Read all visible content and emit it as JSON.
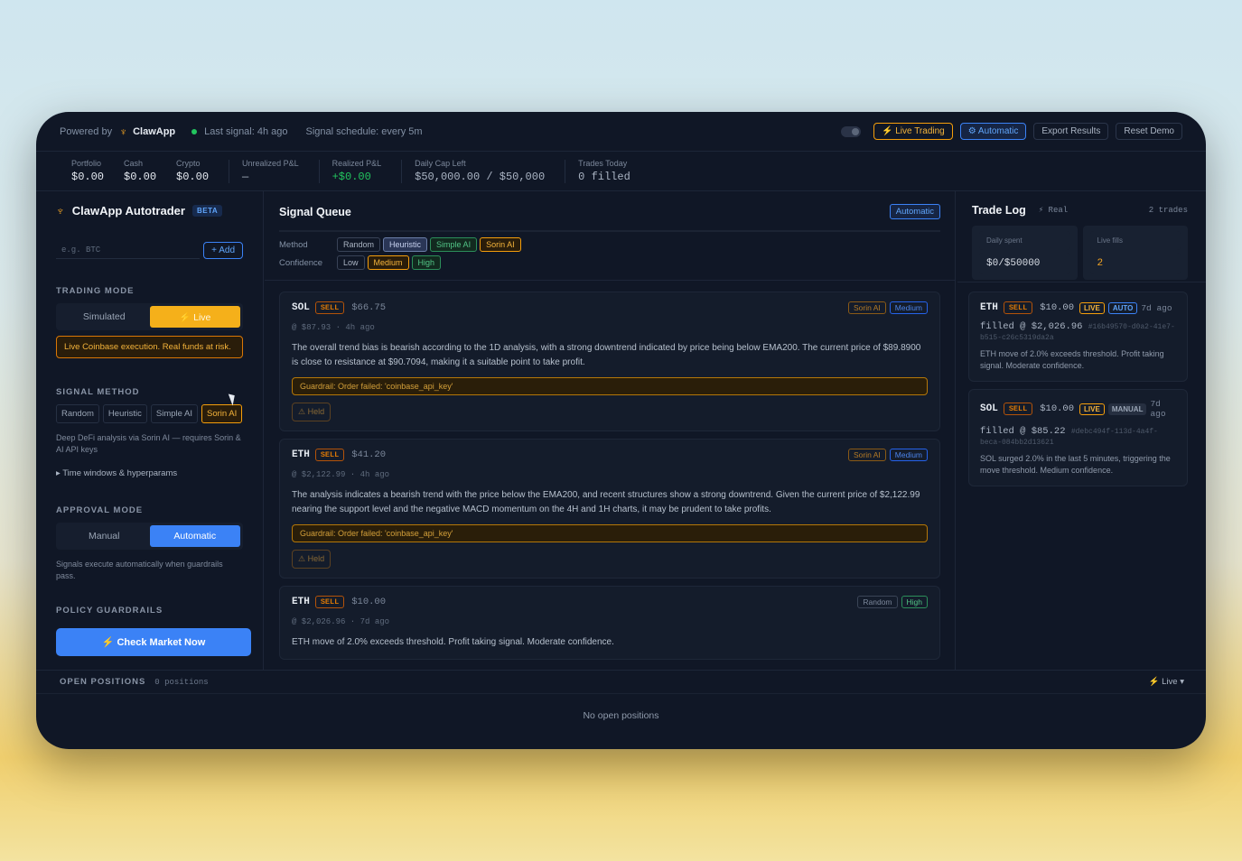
{
  "topbar": {
    "powered_by": "Powered by",
    "brand": "ClawApp",
    "last_signal": "Last signal: 4h ago",
    "schedule": "Signal schedule: every 5m",
    "live_trading": "⚡ Live Trading",
    "automatic": "⚙ Automatic",
    "export": "Export Results",
    "reset": "Reset Demo"
  },
  "stats": [
    {
      "label": "Portfolio",
      "value": "$0.00"
    },
    {
      "label": "Cash",
      "value": "$0.00"
    },
    {
      "label": "Crypto",
      "value": "$0.00"
    },
    {
      "label": "Unrealized P&L",
      "value": "—"
    },
    {
      "label": "Realized P&L",
      "value": "+$0.00"
    },
    {
      "label": "Daily Cap Left",
      "value": "$50,000.00 / $50,000"
    },
    {
      "label": "Trades Today",
      "value": "0 filled"
    }
  ],
  "sidebar": {
    "title": "ClawApp Autotrader",
    "beta": "BETA",
    "add_placeholder": "e.g. BTC",
    "add_label": "+ Add",
    "trading_mode": {
      "heading": "TRADING MODE",
      "simulated": "Simulated",
      "live": "⚡ Live",
      "warning": "Live Coinbase execution. Real funds at risk."
    },
    "signal_method": {
      "heading": "SIGNAL METHOD",
      "options": [
        "Random",
        "Heuristic",
        "Simple AI",
        "Sorin AI"
      ],
      "note": "Deep DeFi analysis via Sorin AI — requires Sorin & AI API keys",
      "hyperparams": "▸ Time windows & hyperparams"
    },
    "approval_mode": {
      "heading": "APPROVAL MODE",
      "manual": "Manual",
      "automatic": "Automatic",
      "note": "Signals execute automatically when guardrails pass."
    },
    "policy": {
      "heading": "POLICY GUARDRAILS"
    },
    "check_market": "⚡ Check Market Now"
  },
  "queue": {
    "title": "Signal Queue",
    "badge": "Automatic",
    "method_label": "Method",
    "methods": [
      "Random",
      "Heuristic",
      "Simple AI",
      "Sorin AI"
    ],
    "confidence_label": "Confidence",
    "confidences": [
      "Low",
      "Medium",
      "High"
    ],
    "cards": [
      {
        "sym": "SOL",
        "side": "SELL",
        "price": "$66.75",
        "source": "Sorin AI",
        "conf": "Medium",
        "sub": "@ $87.93 · 4h ago",
        "body": "The overall trend bias is bearish according to the 1D analysis, with a strong downtrend indicated by price being below EMA200. The current price of $89.8900 is close to resistance at $90.7094, making it a suitable point to take profit.",
        "guard": "Guardrail: Order failed: 'coinbase_api_key'",
        "held": "⚠ Held"
      },
      {
        "sym": "ETH",
        "side": "SELL",
        "price": "$41.20",
        "source": "Sorin AI",
        "conf": "Medium",
        "sub": "@ $2,122.99 · 4h ago",
        "body": "The analysis indicates a bearish trend with the price below the EMA200, and recent structures show a strong downtrend. Given the current price of $2,122.99 nearing the support level and the negative MACD momentum on the 4H and 1H charts, it may be prudent to take profits.",
        "guard": "Guardrail: Order failed: 'coinbase_api_key'",
        "held": "⚠ Held"
      },
      {
        "sym": "ETH",
        "side": "SELL",
        "price": "$10.00",
        "source": "Random",
        "conf": "High",
        "sub": "@ $2,026.96 · 7d ago",
        "body": "ETH move of 2.0% exceeds threshold. Profit taking signal. Moderate confidence."
      }
    ]
  },
  "tradelog": {
    "title": "Trade Log",
    "real": "⚡ Real",
    "count": "2 trades",
    "daily_spent_label": "Daily spent",
    "daily_spent": "$0/$50000",
    "live_fills_label": "Live fills",
    "live_fills": "2",
    "items": [
      {
        "sym": "ETH",
        "side": "SELL",
        "amt": "$10.00",
        "tag1": "LIVE",
        "tag2": "AUTO",
        "ago": "7d ago",
        "fill": "filled @ $2,026.96",
        "hash": "#16b49570-d0a2-41e7-b515-c26c5319da2a",
        "note": "ETH move of 2.0% exceeds threshold. Profit taking signal. Moderate confidence."
      },
      {
        "sym": "SOL",
        "side": "SELL",
        "amt": "$10.00",
        "tag1": "LIVE",
        "tag2": "MANUAL",
        "ago": "7d ago",
        "fill": "filled @ $85.22",
        "hash": "#debc494f-113d-4a4f-beca-084bb2d13621",
        "note": "SOL surged 2.0% in the last 5 minutes, triggering the move threshold. Medium confidence."
      }
    ]
  },
  "positions": {
    "title": "OPEN POSITIONS",
    "count": "0 positions",
    "live": "Live",
    "empty": "No open positions"
  }
}
